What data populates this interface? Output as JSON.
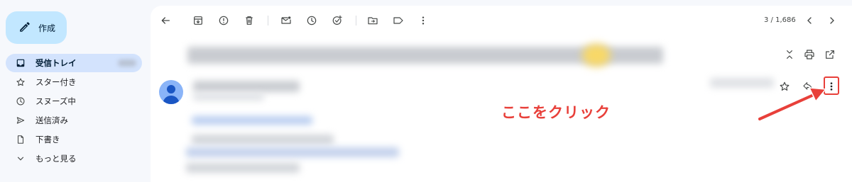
{
  "sidebar": {
    "compose_label": "作成",
    "items": [
      {
        "label": "受信トレイ",
        "icon": "inbox-icon",
        "active": true
      },
      {
        "label": "スター付き",
        "icon": "star-icon"
      },
      {
        "label": "スヌーズ中",
        "icon": "clock-icon"
      },
      {
        "label": "送信済み",
        "icon": "send-icon"
      },
      {
        "label": "下書き",
        "icon": "draft-icon"
      },
      {
        "label": "もっと見る",
        "icon": "chevron-down-icon"
      }
    ]
  },
  "toolbar": {
    "pager_text": "3 / 1,686",
    "icons": [
      "back-arrow-icon",
      "archive-icon",
      "report-spam-icon",
      "delete-icon",
      "mark-unread-icon",
      "snooze-icon",
      "add-task-icon",
      "move-to-icon",
      "label-icon",
      "more-vert-icon",
      "prev-icon",
      "next-icon"
    ]
  },
  "annotation": {
    "text": "ここをクリック",
    "color": "#e8403a"
  },
  "colors": {
    "compose_bg": "#c2e7ff",
    "active_nav_bg": "#d3e3fd",
    "page_bg": "#f6f8fc",
    "avatar": "#8ab4f8"
  }
}
